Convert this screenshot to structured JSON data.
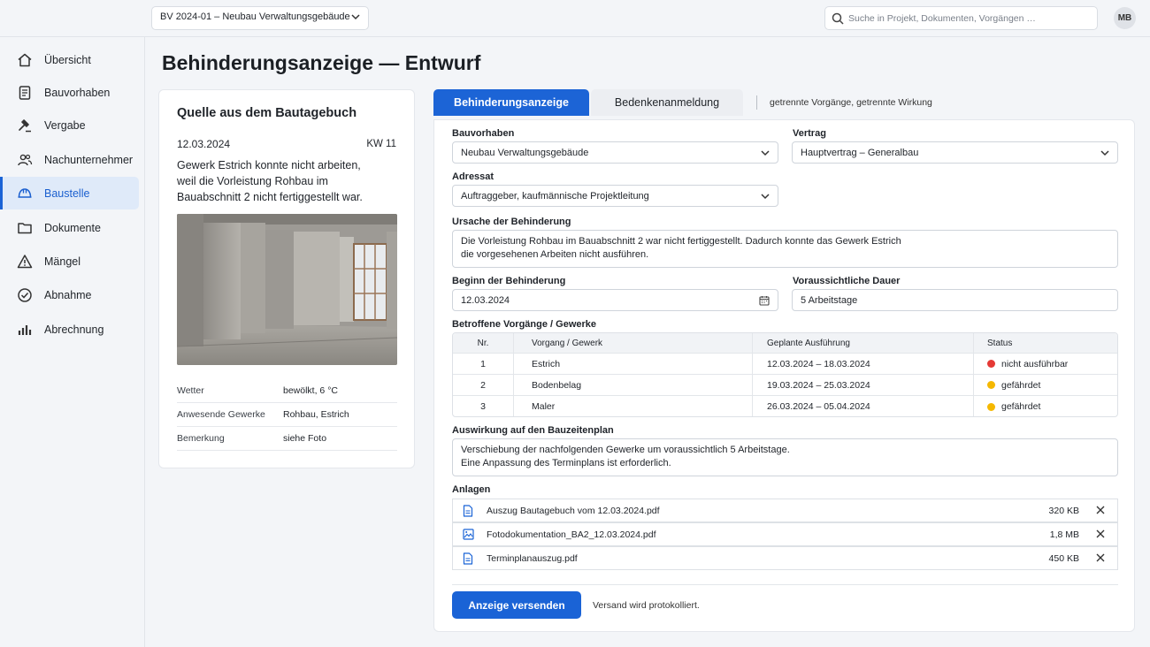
{
  "topbar": {
    "project": "BV 2024-01 – Neubau Verwaltungsgebäude",
    "search_placeholder": "Suche in Projekt, Dokumenten, Vorgängen …",
    "avatar": "MB"
  },
  "sidebar": {
    "items": [
      {
        "label": "Übersicht",
        "icon": "home-icon"
      },
      {
        "label": "Bauvorhaben",
        "icon": "document-icon"
      },
      {
        "label": "Vergabe",
        "icon": "gavel-icon"
      },
      {
        "label": "Nachunternehmer",
        "icon": "users-icon"
      },
      {
        "label": "Baustelle",
        "icon": "helmet-icon",
        "active": true
      },
      {
        "label": "Dokumente",
        "icon": "folder-icon"
      },
      {
        "label": "Mängel",
        "icon": "warning-icon"
      },
      {
        "label": "Abnahme",
        "icon": "check-circle-icon"
      },
      {
        "label": "Abrechnung",
        "icon": "bar-chart-icon"
      }
    ]
  },
  "page_title": "Behinderungsanzeige — Entwurf",
  "source": {
    "title": "Quelle aus dem Bautagebuch",
    "date": "12.03.2024",
    "week": "KW 11",
    "text": "Gewerk Estrich konnte nicht arbeiten, weil die Vorleistung Rohbau im Bauabschnitt 2 nicht fertiggestellt war.",
    "rows": [
      {
        "key": "Wetter",
        "value": "bewölkt, 6 °C"
      },
      {
        "key": "Anwesende Gewerke",
        "value": "Rohbau, Estrich"
      },
      {
        "key": "Bemerkung",
        "value": "siehe Foto"
      }
    ]
  },
  "tabs": {
    "active": "Behinderungsanzeige",
    "other": "Bedenkenanmeldung",
    "note": "getrennte Vorgänge, getrennte Wirkung"
  },
  "form": {
    "bauvorhaben_label": "Bauvorhaben",
    "bauvorhaben_value": "Neubau Verwaltungsgebäude",
    "vertrag_label": "Vertrag",
    "vertrag_value": "Hauptvertrag – Generalbau",
    "adressat_label": "Adressat",
    "adressat_value": "Auftraggeber, kaufmännische Projektleitung",
    "ursache_label": "Ursache der Behinderung",
    "ursache_line1": "Die Vorleistung Rohbau im Bauabschnitt 2 war nicht fertiggestellt. Dadurch konnte das Gewerk Estrich",
    "ursache_line2": "die vorgesehenen Arbeiten nicht ausführen.",
    "beginn_label": "Beginn der Behinderung",
    "beginn_value": "12.03.2024",
    "dauer_label": "Voraussichtliche Dauer",
    "dauer_value": "5 Arbeitstage",
    "betroffen_label": "Betroffene Vorgänge / Gewerke",
    "auswirkung_label": "Auswirkung auf den Bauzeitenplan",
    "auswirkung_line1": "Verschiebung der nachfolgenden Gewerke um voraussichtlich 5 Arbeitstage.",
    "auswirkung_line2": "Eine Anpassung des Terminplans ist erforderlich.",
    "anlagen_label": "Anlagen"
  },
  "table": {
    "headers": [
      "Nr.",
      "Vorgang / Gewerk",
      "Geplante Ausführung",
      "Status"
    ],
    "rows": [
      {
        "nr": "1",
        "gewerk": "Estrich",
        "zeitraum": "12.03.2024 – 18.03.2024",
        "status": "nicht ausführbar",
        "color": "#e53935"
      },
      {
        "nr": "2",
        "gewerk": "Bodenbelag",
        "zeitraum": "19.03.2024 – 25.03.2024",
        "status": "gefährdet",
        "color": "#f5b800"
      },
      {
        "nr": "3",
        "gewerk": "Maler",
        "zeitraum": "26.03.2024 – 05.04.2024",
        "status": "gefährdet",
        "color": "#f5b800"
      }
    ]
  },
  "attachments": [
    {
      "name": "Auszug Bautagebuch vom 12.03.2024.pdf",
      "size": "320 KB",
      "icon": "file-icon"
    },
    {
      "name": "Fotodokumentation_BA2_12.03.2024.pdf",
      "size": "1,8 MB",
      "icon": "image-file-icon"
    },
    {
      "name": "Terminplanauszug.pdf",
      "size": "450 KB",
      "icon": "file-icon"
    }
  ],
  "actions": {
    "send": "Anzeige versenden",
    "note": "Versand wird protokolliert."
  },
  "colors": {
    "accent": "#1a63d6",
    "danger": "#e53935",
    "warning": "#f5b800"
  }
}
